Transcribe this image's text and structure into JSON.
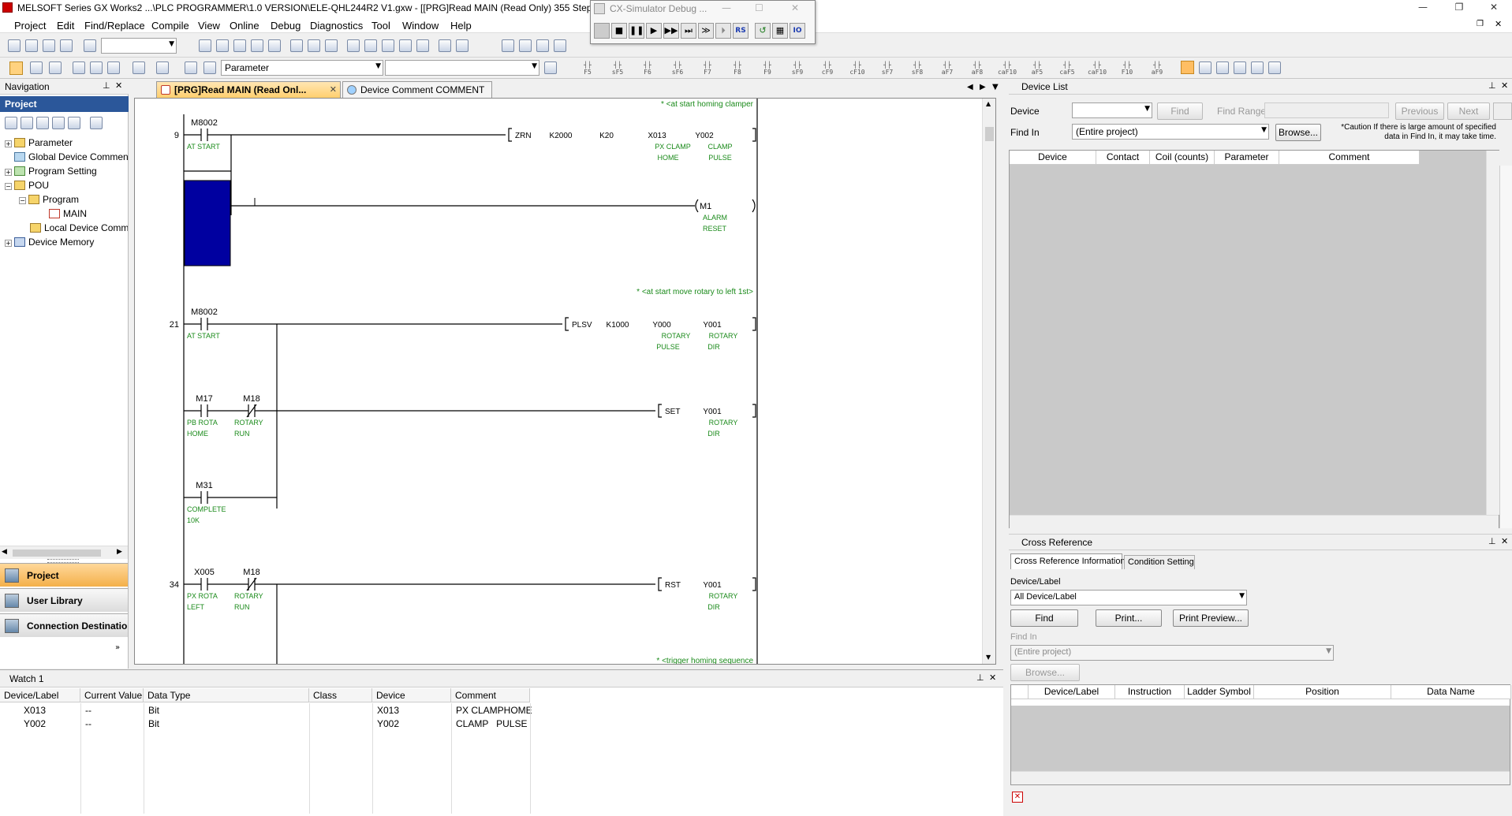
{
  "window": {
    "title": "MELSOFT Series GX Works2 ...\\PLC PROGRAMMER\\1.0 VERSION\\ELE-QHL244R2 V1.gxw - [[PRG]Read MAIN (Read Only) 355 Step]",
    "minimize": "—",
    "restore": "❐",
    "close": "✕"
  },
  "menu": [
    "Project",
    "Edit",
    "Find/Replace",
    "Compile",
    "View",
    "Online",
    "Debug",
    "Diagnostics",
    "Tool",
    "Window",
    "Help"
  ],
  "toolbar": {
    "parameter_dropdown": "Parameter",
    "fkeys": [
      "F5",
      "sF5",
      "F6",
      "sF6",
      "F7",
      "F8",
      "F9",
      "sF9",
      "cF9",
      "cF10",
      "sF7",
      "sF8",
      "aF7",
      "aF8",
      "caF10",
      "aF5",
      "caF5",
      "caF10",
      "F10",
      "aF9"
    ]
  },
  "simulator": {
    "title": "CX-Simulator Debug ...",
    "buttons": [
      "■",
      "❚❚",
      "▶",
      "▶▶",
      "⏭",
      "≫",
      "⏵",
      "RS",
      "↺",
      "▦",
      "IO"
    ]
  },
  "navigation": {
    "title": "Navigation",
    "section": "Project",
    "tree": [
      {
        "label": "Parameter",
        "level": 0,
        "expander": "+"
      },
      {
        "label": "Global Device Comment",
        "level": 0,
        "expander": ""
      },
      {
        "label": "Program Setting",
        "level": 0,
        "expander": "+"
      },
      {
        "label": "POU",
        "level": 0,
        "expander": "−"
      },
      {
        "label": "Program",
        "level": 1,
        "expander": "−"
      },
      {
        "label": "MAIN",
        "level": 2,
        "expander": ""
      },
      {
        "label": "Local Device Comment",
        "level": 1,
        "expander": ""
      },
      {
        "label": "Device Memory",
        "level": 0,
        "expander": "+"
      }
    ],
    "bottom_buttons": [
      "Project",
      "User Library",
      "Connection Destination"
    ]
  },
  "tabs": [
    {
      "label": "[PRG]Read MAIN (Read Onl...",
      "active": true
    },
    {
      "label": "Device Comment COMMENT",
      "active": false
    }
  ],
  "ladder": {
    "comments": {
      "c1": "* <at start homing clamper",
      "c2": "* <at start move rotary to left  1st>",
      "c3": "* <trigger homing sequence"
    },
    "steps": {
      "s1": "9",
      "s2": "21",
      "s3": "34"
    },
    "r1": {
      "contact": "M8002",
      "contact_cmt": "AT START",
      "instr": "ZRN",
      "op1": "K2000",
      "op2": "K20",
      "op3": "X013",
      "op3_c1": "PX CLAMP",
      "op3_c2": "HOME",
      "op4": "Y002",
      "op4_c1": "CLAMP",
      "op4_c2": "PULSE"
    },
    "r1b": {
      "coil": "M1",
      "coil_c1": "ALARM",
      "coil_c2": "RESET"
    },
    "r2": {
      "contact": "M8002",
      "contact_cmt": "AT START",
      "instr": "PLSV",
      "op1": "K1000",
      "op2": "Y000",
      "op2_c1": "ROTARY",
      "op2_c2": "PULSE",
      "op3": "Y001",
      "op3_c1": "ROTARY",
      "op3_c2": "DIR"
    },
    "r3": {
      "c1": "M17",
      "c1_c1": "PB ROTA",
      "c1_c2": "HOME",
      "c2": "M18",
      "c2_c1": "ROTARY",
      "c2_c2": "RUN",
      "instr": "SET",
      "op": "Y001",
      "op_c1": "ROTARY",
      "op_c2": "DIR"
    },
    "r4": {
      "c1": "M31",
      "c1_c1": "COMPLETE",
      "c1_c2": "10K"
    },
    "r5": {
      "c1": "X005",
      "c1_c1": "PX ROTA",
      "c1_c2": "LEFT",
      "c2": "M18",
      "c2_c1": "ROTARY",
      "c2_c2": "RUN",
      "instr": "RST",
      "op": "Y001",
      "op_c1": "ROTARY",
      "op_c2": "DIR"
    }
  },
  "device_list": {
    "title": "Device List",
    "device_label": "Device",
    "find_button": "Find",
    "find_range_label": "Find Range",
    "previous_button": "Previous",
    "next_button": "Next",
    "find_in_label": "Find In",
    "find_in_value": "(Entire project)",
    "browse_button": "Browse...",
    "caution": "*Caution If there is large amount of specified data in Find In, it may take time.",
    "columns": [
      "Device",
      "Contact",
      "Coil (counts)",
      "Parameter",
      "Comment"
    ]
  },
  "cross_reference": {
    "title": "Cross Reference",
    "tabs": [
      "Cross Reference Information",
      "Condition Setting"
    ],
    "device_label_label": "Device/Label",
    "device_label_value": "All Device/Label",
    "find_button": "Find",
    "print_button": "Print...",
    "print_preview_button": "Print Preview...",
    "find_in_label": "Find In",
    "find_in_value": "(Entire project)",
    "browse_button": "Browse...",
    "columns": [
      "Device/Label",
      "Instruction",
      "Ladder Symbol",
      "Position",
      "Data Name"
    ]
  },
  "watch": {
    "title": "Watch 1",
    "columns": [
      "Device/Label",
      "Current Value",
      "Data Type",
      "Class",
      "Device",
      "Comment"
    ],
    "rows": [
      {
        "label": "X013",
        "value": "--",
        "type": "Bit",
        "class": "",
        "device": "X013",
        "comment": "PX CLAMPHOME"
      },
      {
        "label": "Y002",
        "value": "--",
        "type": "Bit",
        "class": "",
        "device": "Y002",
        "comment": "CLAMP   PULSE"
      }
    ]
  },
  "colors": {
    "ladder_comment": "#1a8a1a",
    "selection": "#0000a0",
    "active_tab": "#ffcf6e",
    "nav_section": "#2b579a"
  }
}
